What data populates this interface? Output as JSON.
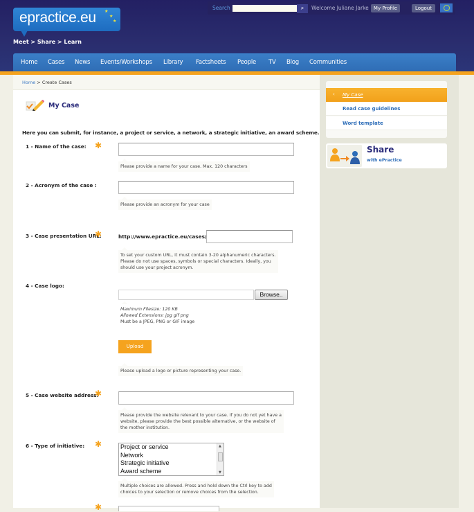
{
  "header": {
    "logo_text": "epractice.eu",
    "tagline": "Meet > Share > Learn",
    "search_label": "Search",
    "search_value": "",
    "welcome": "Welcome Juliane Jarke",
    "my_profile": "My Profile",
    "logout": "Logout"
  },
  "nav": {
    "items": [
      "Home",
      "Cases",
      "News",
      "Events/Workshops",
      "Library",
      "Factsheets",
      "People",
      "TV",
      "Blog",
      "Communities"
    ]
  },
  "breadcrumb": {
    "home": "Home",
    "separator": ">",
    "current": "Create Cases"
  },
  "page": {
    "title": "My Case",
    "intro": "Here you can submit, for instance, a project or service, a network, a strategic initiative, an award scheme.",
    "required_mark": "✱"
  },
  "form": {
    "name": {
      "label": "1 - Name of the case:",
      "value": "",
      "hint": "Please provide a name for your case. Max. 120 characters"
    },
    "acronym": {
      "label": "2 - Acronym of the case :",
      "value": "",
      "hint": "Please provide an acronym for your case"
    },
    "url": {
      "label": "3 - Case presentation URL:",
      "prefix": "http://www.epractice.eu/cases/",
      "value": "",
      "hint_lines": [
        "To set your custom URL, it must contain 3-20 alphanumeric characters.",
        "Please do not use spaces, symbols or special characters. Ideally, you",
        "should use your project acronym."
      ]
    },
    "logo": {
      "label": "4 - Case logo:",
      "file_value": "",
      "browse_label": "Browse..",
      "max_filesize_label": "Maximum Filesize:",
      "max_filesize_value": "120 KB",
      "extensions_label": "Allowed Extensions:",
      "extensions_value": "jpg gif png",
      "format_note": "Must be a JPEG, PNG or GIF image",
      "upload_label": "Upload",
      "hint": "Please upload a logo or picture representing your case."
    },
    "website": {
      "label": "5 - Case website address:",
      "value": "",
      "hint_lines": [
        "Please provide the website relevant to your case. If you do not yet have a",
        "website, please provide the best possible alternative, or the website of",
        "the mother institution."
      ]
    },
    "initiative": {
      "label": "6 - Type of initiative:",
      "options": [
        "Project or service",
        "Network",
        "Strategic initiative",
        "Award scheme"
      ],
      "hint_lines": [
        "Multiple choices are allowed. Press and hold down the Ctrl key to add",
        "choices to your selection or remove choices from the selection."
      ]
    }
  },
  "sidebar": {
    "items": [
      {
        "label": "My Case",
        "active": true
      },
      {
        "label": "Read case guidelines",
        "active": false
      },
      {
        "label": "Word template",
        "active": false
      }
    ],
    "share_title": "Share",
    "share_subtitle": "with ePractice"
  },
  "colors": {
    "header_bg": "#232063",
    "nav_bg": "#3b7fc8",
    "accent_orange": "#f5a31e",
    "title_navy": "#2a2b7a",
    "link_blue": "#2d6db8"
  }
}
